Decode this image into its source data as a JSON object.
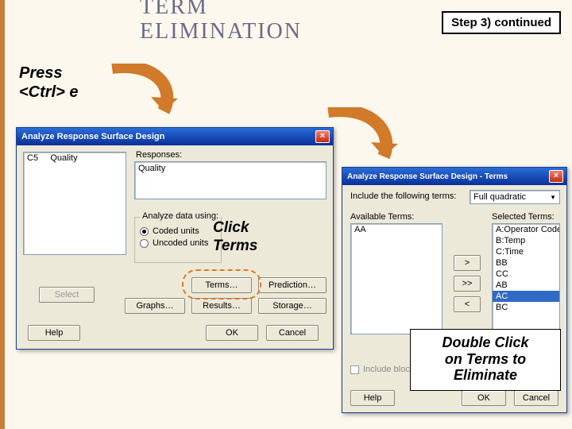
{
  "slide": {
    "title_line1": "TERM",
    "title_line2": "ELIMINATION",
    "step_badge": "Step 3) continued",
    "instr_press_l1": "Press",
    "instr_press_l2": "<Ctrl> e",
    "instr_click_l1": "Click",
    "instr_click_l2": "Terms",
    "instr_double_l1": "Double Click",
    "instr_double_l2": "on Terms to",
    "instr_double_l3": "Eliminate"
  },
  "dialog1": {
    "title": "Analyze Response Surface Design",
    "var_col": "C5",
    "var_name": "Quality",
    "responses_label": "Responses:",
    "responses_value": "Quality",
    "analyze_label": "Analyze data using:",
    "radio_coded": "Coded units",
    "radio_uncoded": "Uncoded units",
    "btn_select": "Select",
    "btn_terms": "Terms…",
    "btn_prediction": "Prediction…",
    "btn_graphs": "Graphs…",
    "btn_results": "Results…",
    "btn_storage": "Storage…",
    "btn_help": "Help",
    "btn_ok": "OK",
    "btn_cancel": "Cancel"
  },
  "dialog2": {
    "title": "Analyze Response Surface Design  -  Terms",
    "include_label": "Include the following terms:",
    "include_value": "Full quadratic",
    "avail_label": "Available Terms:",
    "sel_label": "Selected Terms:",
    "avail_items": [
      "AA"
    ],
    "sel_items": [
      "A:Operator Code",
      "B:Temp",
      "C:Time",
      "BB",
      "CC",
      "AB",
      "AC",
      "BC"
    ],
    "sel_highlight_index": 6,
    "btn_right": ">",
    "btn_rightall": ">>",
    "btn_left": "<",
    "chk_blocks": "Include blocks",
    "btn_help": "Help",
    "btn_ok": "OK",
    "btn_cancel": "Cancel"
  }
}
